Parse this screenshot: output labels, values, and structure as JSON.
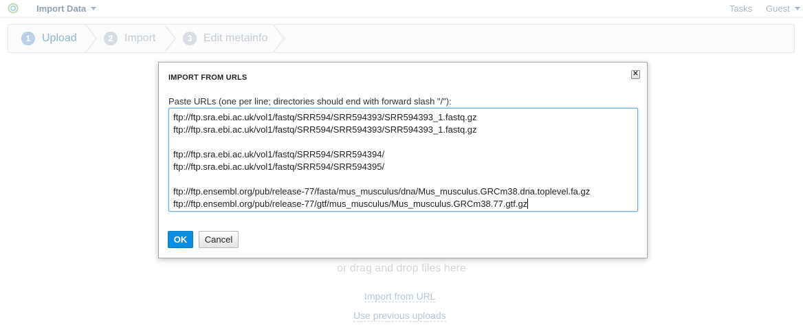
{
  "topbar": {
    "app_menu_label": "Import Data",
    "tasks_label": "Tasks",
    "user_label": "Guest"
  },
  "steps": [
    {
      "number": "1",
      "label": "Upload",
      "active": true
    },
    {
      "number": "2",
      "label": "Import",
      "active": false
    },
    {
      "number": "3",
      "label": "Edit metainfo",
      "active": false
    }
  ],
  "background": {
    "drop_text": "or drag and drop files here",
    "import_url_link": "Import from URL",
    "previous_uploads_link": "Use previous uploads"
  },
  "modal": {
    "title": "IMPORT FROM URLS",
    "close_symbol": "✕",
    "instructions": "Paste URLs (one per line; directories should end with forward slash \"/\"):",
    "url_lines": [
      "ftp://ftp.sra.ebi.ac.uk/vol1/fastq/SRR594/SRR594393/SRR594393_1.fastq.gz",
      "ftp://ftp.sra.ebi.ac.uk/vol1/fastq/SRR594/SRR594393/SRR594393_1.fastq.gz",
      "",
      "ftp://ftp.sra.ebi.ac.uk/vol1/fastq/SRR594/SRR594394/",
      "ftp://ftp.sra.ebi.ac.uk/vol1/fastq/SRR594/SRR594395/",
      "",
      "ftp://ftp.ensembl.org/pub/release-77/fasta/mus_musculus/dna/Mus_musculus.GRCm38.dna.toplevel.fa.gz",
      "ftp://ftp.ensembl.org/pub/release-77/gtf/mus_musculus/Mus_musculus.GRCm38.77.gtf.gz"
    ],
    "ok_label": "OK",
    "cancel_label": "Cancel"
  },
  "colors": {
    "primary_button": "#0b8ee0",
    "focus_border": "#6aa7e8"
  }
}
